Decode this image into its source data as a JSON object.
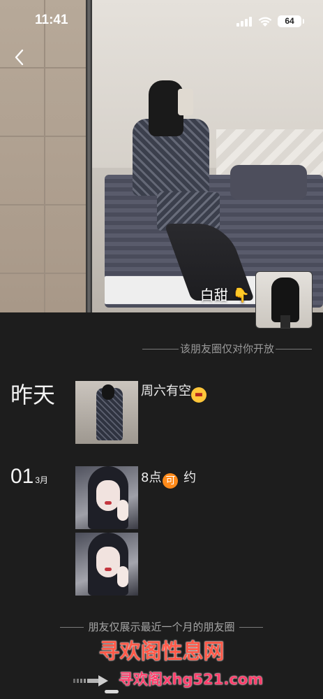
{
  "status_bar": {
    "time": "11:41",
    "battery": "64"
  },
  "cover": {
    "nickname": "白甜",
    "nickname_emoji": "👇"
  },
  "privacy_note": "该朋友圈仅对你开放",
  "posts": [
    {
      "date_label": "昨天",
      "text": "周六有空",
      "emoji": "😬"
    },
    {
      "date_day": "01",
      "date_month": "3月",
      "text_before": "8点",
      "emoji_text": "可",
      "text_after": " 约"
    }
  ],
  "footer_note": "朋友仅展示最近一个月的朋友圈",
  "watermark": {
    "title": "寻欢阁性息网",
    "url": "寻欢阁xhg521.com",
    "url_prefix": "x"
  },
  "icons": {
    "back": "chevron-left-icon",
    "signal": "cellular-signal-icon",
    "wifi": "wifi-icon",
    "battery": "battery-icon"
  },
  "colors": {
    "background": "#1d1d1d",
    "watermark_red": "#ff5a49",
    "watermark_pink": "#ff3f6c",
    "emoji_orange": "#ff8a1a"
  }
}
